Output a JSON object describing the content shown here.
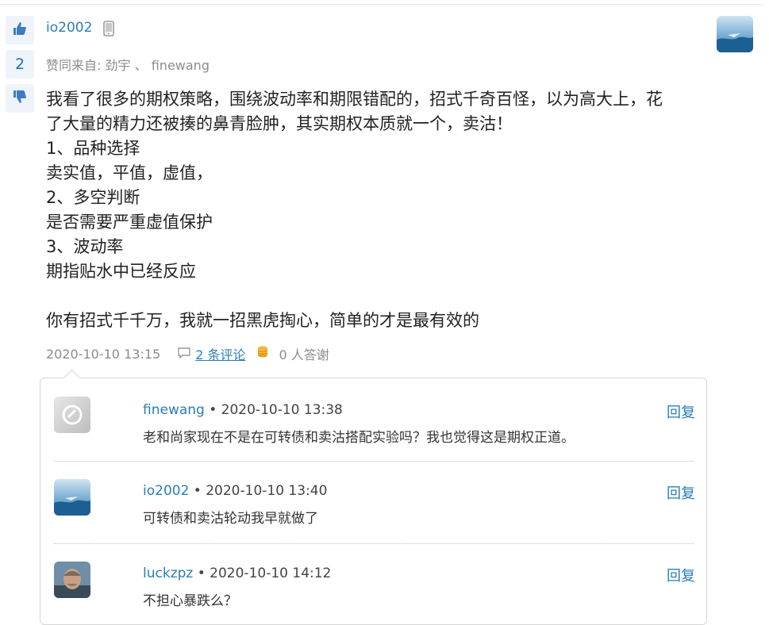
{
  "answer": {
    "author": "io2002",
    "vote_count": "2",
    "agree_prefix": "赞同来自:",
    "agree_users": [
      "劲宇",
      "finewang"
    ],
    "agree_separator": "、",
    "content_lines": [
      "我看了很多的期权策略，围绕波动率和期限错配的，招式千奇百怪，以为高大上，花",
      "了大量的精力还被揍的鼻青脸肿，其实期权本质就一个，卖沽！",
      "1、品种选择",
      "卖实值，平值，虚值，",
      "2、多空判断",
      "是否需要严重虚值保护",
      "3、波动率",
      "期指贴水中已经反应",
      "",
      "你有招式千千万，我就一招黑虎掏心，简单的才是最有效的"
    ],
    "date": "2020-10-10 13:15",
    "comments_link": " 2 条评论",
    "thanks": "0 人答谢"
  },
  "comments": [
    {
      "user": "finewang",
      "time": "2020-10-10 13:38",
      "text": "老和尚家现在不是在可转债和卖沽搭配实验吗？我也觉得这是期权正道。",
      "reply": "回复"
    },
    {
      "user": "io2002",
      "time": "2020-10-10 13:40",
      "text": "可转债和卖沽轮动我早就做了",
      "reply": "回复"
    },
    {
      "user": "luckzpz",
      "time": "2020-10-10 14:12",
      "text": "不担心暴跌么？",
      "reply": "回复"
    }
  ],
  "icons": {
    "vote_up": "thumbs-up-icon",
    "vote_down": "thumbs-down-icon",
    "device": "mobile-phone-icon",
    "comment": "comment-icon",
    "coins": "coins-icon"
  },
  "colors": {
    "link": "#2a7db8",
    "muted": "#8c8c8c",
    "vote_bg": "#eef4fa"
  }
}
